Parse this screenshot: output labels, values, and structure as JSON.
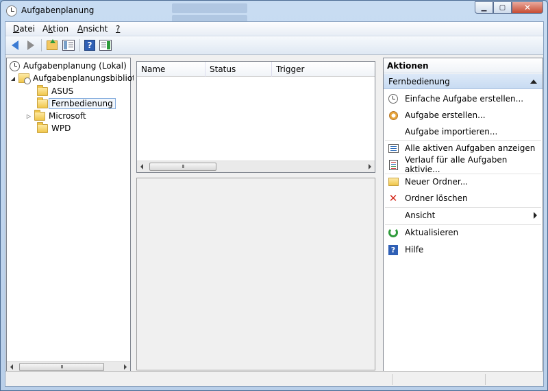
{
  "window": {
    "title": "Aufgabenplanung"
  },
  "menu": [
    {
      "label": "Datei",
      "key": "D",
      "rest": "atei"
    },
    {
      "label": "Aktion",
      "pre": "A",
      "key": "k",
      "rest": "tion"
    },
    {
      "label": "Ansicht",
      "key": "A",
      "rest": "nsicht"
    },
    {
      "label": "?",
      "key": "?",
      "rest": ""
    }
  ],
  "toolbar": {
    "icons": [
      "back-arrow-icon",
      "forward-arrow-icon",
      "up-folder-icon",
      "show-hide-console-tree-icon",
      "help-icon",
      "show-hide-action-pane-icon"
    ]
  },
  "tree": {
    "root": "Aufgabenplanung (Lokal)",
    "library": "Aufgabenplanungsbibliothek",
    "folders": [
      "ASUS",
      "Fernbedienung",
      "Microsoft",
      "WPD"
    ],
    "selected": "Fernbedienung"
  },
  "list": {
    "columns": [
      "Name",
      "Status",
      "Trigger"
    ]
  },
  "actions": {
    "header": "Aktionen",
    "section": "Fernbedienung",
    "items": [
      {
        "label": "Einfache Aufgabe erstellen...",
        "icon": "clock-icon"
      },
      {
        "label": "Aufgabe erstellen...",
        "icon": "task-icon"
      },
      {
        "label": "Aufgabe importieren...",
        "icon": ""
      },
      {
        "label": "Alle aktiven Aufgaben anzeigen",
        "icon": "list-icon"
      },
      {
        "label": "Verlauf für alle Aufgaben aktivie...",
        "icon": "history-icon"
      },
      {
        "label": "Neuer Ordner...",
        "icon": "folder-icon"
      },
      {
        "label": "Ordner löschen",
        "icon": "delete-icon"
      },
      {
        "label": "Ansicht",
        "icon": ""
      },
      {
        "label": "Aktualisieren",
        "icon": "refresh-icon"
      },
      {
        "label": "Hilfe",
        "icon": "help-icon"
      }
    ]
  },
  "scroll": {
    "thumb_glyph": "III"
  },
  "colors": {
    "titlebar": "#c8dcf2",
    "selection_border": "#84acdd",
    "actions_section": "#c8dbf2",
    "close_button": "#c74b32"
  }
}
